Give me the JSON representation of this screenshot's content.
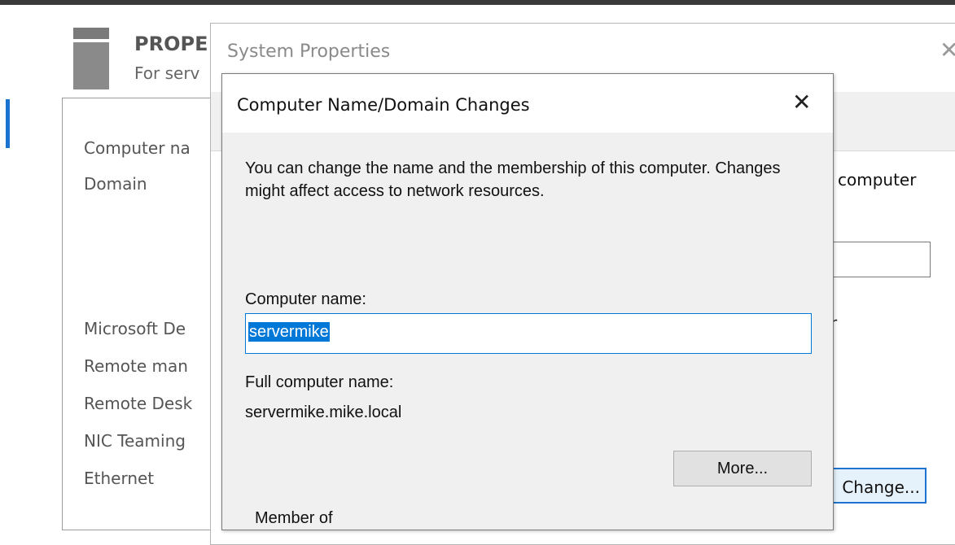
{
  "background": {
    "title": "PROPE",
    "subtitle": "For serv",
    "labels": [
      "Computer na",
      "Domain",
      "Microsoft De",
      "Remote man",
      "Remote Desk",
      "NIC Teaming",
      "Ethernet"
    ]
  },
  "system_properties": {
    "title": "System Properties",
    "close_glyph": "✕",
    "partial_text": "computer",
    "partial_letter": "r",
    "change_button_label": "Change..."
  },
  "dialog": {
    "title": "Computer Name/Domain Changes",
    "close_glyph": "✕",
    "description": "You can change the name and the membership of this computer. Changes might affect access to network resources.",
    "computer_name_label": "Computer name:",
    "computer_name_value": "servermike",
    "full_name_label": "Full computer name:",
    "full_name_value": "servermike.mike.local",
    "more_button_label": "More...",
    "member_of_partial": "Member of"
  }
}
